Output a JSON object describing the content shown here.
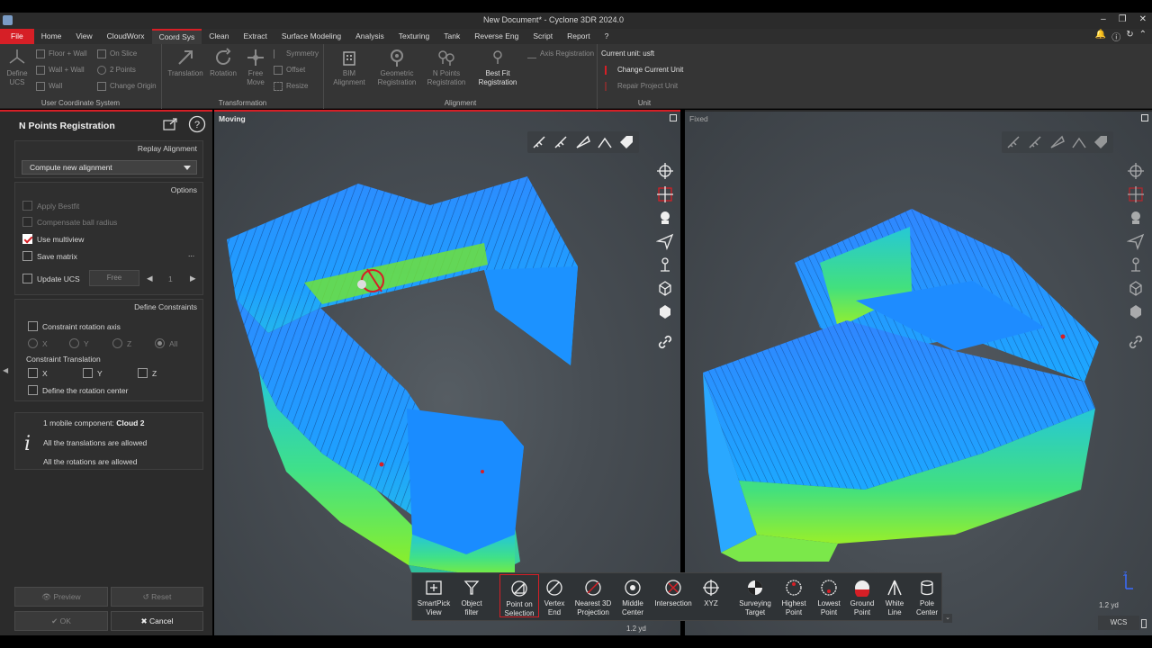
{
  "window": {
    "title": "New Document* - Cyclone 3DR 2024.0"
  },
  "menu": [
    "File",
    "Home",
    "View",
    "CloudWorx",
    "Coord Sys",
    "Clean",
    "Extract",
    "Surface Modeling",
    "Analysis",
    "Texturing",
    "Tank",
    "Reverse Eng",
    "Script",
    "Report",
    "?"
  ],
  "ribbon": {
    "ucs": {
      "title": "User Coordinate System",
      "define_ucs": "Define UCS",
      "floor_wall": "Floor + Wall",
      "wall_wall": "Wall + Wall",
      "wall": "Wall",
      "on_slice": "On Slice",
      "two_points": "2 Points",
      "change_origin": "Change Origin"
    },
    "transformation": {
      "title": "Transformation",
      "translation": "Translation",
      "rotation": "Rotation",
      "free_move": "Free Move",
      "symmetry": "Symmetry",
      "offset": "Offset",
      "resize": "Resize"
    },
    "alignment": {
      "title": "Alignment",
      "bim": "BIM Alignment",
      "geometric": "Geometric Registration",
      "npoints": "N Points Registration",
      "bestfit": "Best Fit Registration",
      "axis": "Axis Registration"
    },
    "unit": {
      "title": "Unit",
      "current": "Current unit: usft",
      "change": "Change Current Unit",
      "repair": "Repair Project Unit"
    }
  },
  "panel": {
    "title": "N Points Registration",
    "replay_header": "Replay Alignment",
    "dropdown_value": "Compute new alignment",
    "options_header": "Options",
    "apply_bestfit": "Apply Bestfit",
    "compensate": "Compensate ball radius",
    "use_multiview": "Use multiview",
    "save_matrix": "Save matrix",
    "save_matrix_more": "...",
    "update_ucs": "Update UCS",
    "free": "Free",
    "index": "1",
    "constraints_header": "Define Constraints",
    "constraint_rotation": "Constraint rotation axis",
    "axis_x": "X",
    "axis_y": "Y",
    "axis_z": "Z",
    "axis_all": "All",
    "constraint_translation": "Constraint Translation",
    "t_x": "X",
    "t_y": "Y",
    "t_z": "Z",
    "define_center": "Define the rotation center",
    "info_line1_prefix": "1 mobile component: ",
    "info_line1_value": "Cloud 2",
    "info_line2": "All the translations are allowed",
    "info_line3": "All the rotations are allowed",
    "preview": "Preview",
    "reset": "Reset",
    "ok": "OK",
    "cancel": "Cancel"
  },
  "viewports": {
    "moving": {
      "label": "Moving",
      "scale": "1.2 yd"
    },
    "fixed": {
      "label": "Fixed",
      "scale": "1.2 yd",
      "wcs": "WCS"
    }
  },
  "snap_tools": [
    {
      "label1": "SmartPick",
      "label2": "View",
      "icon": "smartpick-icon"
    },
    {
      "label1": "Object",
      "label2": "filter",
      "icon": "filter-icon"
    },
    {
      "label1": "Point on",
      "label2": "Selection",
      "icon": "point-on-selection-icon"
    },
    {
      "label1": "Vertex",
      "label2": "End",
      "icon": "vertex-icon"
    },
    {
      "label1": "Nearest 3D",
      "label2": "Projection",
      "icon": "nearest-icon"
    },
    {
      "label1": "Middle",
      "label2": "Center",
      "icon": "middle-icon"
    },
    {
      "label1": "Intersection",
      "label2": "",
      "icon": "intersection-icon"
    },
    {
      "label1": "XYZ",
      "label2": "",
      "icon": "xyz-icon"
    },
    {
      "label1": "Surveying",
      "label2": "Target",
      "icon": "target-icon"
    },
    {
      "label1": "Highest",
      "label2": "Point",
      "icon": "highest-icon"
    },
    {
      "label1": "Lowest",
      "label2": "Point",
      "icon": "lowest-icon"
    },
    {
      "label1": "Ground",
      "label2": "Point",
      "icon": "ground-icon"
    },
    {
      "label1": "White",
      "label2": "Line",
      "icon": "white-line-icon"
    },
    {
      "label1": "Pole",
      "label2": "Center",
      "icon": "pole-icon"
    }
  ],
  "colors": {
    "accent": "#d61f26",
    "panel_bg": "#2b2b2b",
    "ribbon_bg": "#353535"
  }
}
